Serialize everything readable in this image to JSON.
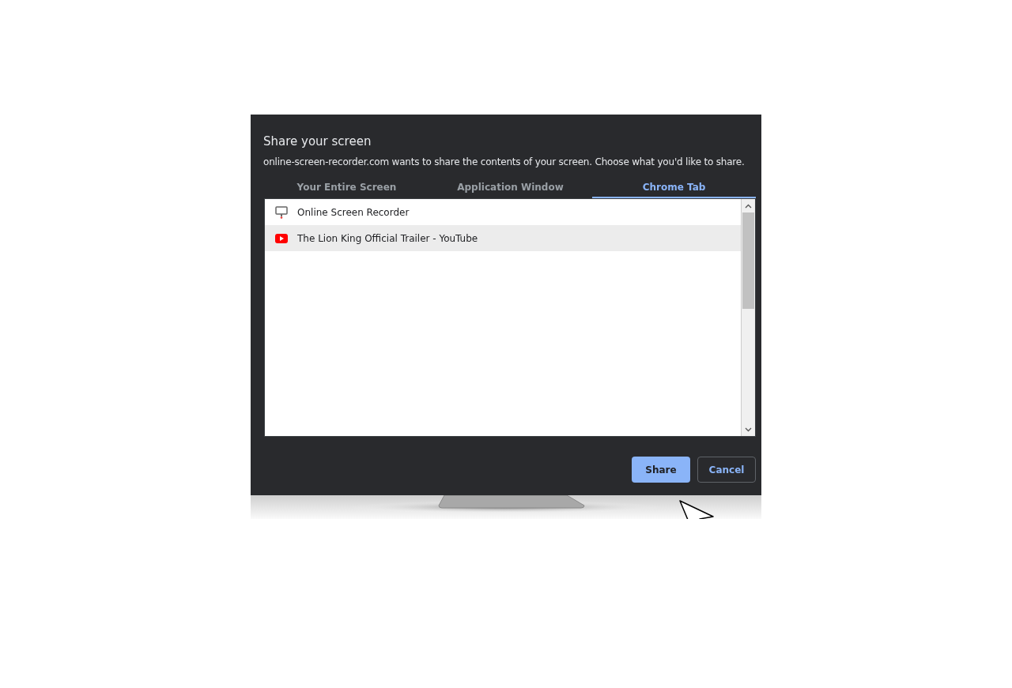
{
  "dialog": {
    "title": "Share your screen",
    "message": "online-screen-recorder.com wants to share the contents of your screen. Choose what you'd like to share.",
    "tabs": [
      {
        "label": "Your Entire Screen",
        "selected": false
      },
      {
        "label": "Application Window",
        "selected": false
      },
      {
        "label": "Chrome Tab",
        "selected": true
      }
    ],
    "items": [
      {
        "kind": "monitor",
        "title": "Online Screen Recorder",
        "selected": false
      },
      {
        "kind": "video",
        "title": "The Lion King Official Trailer - YouTube",
        "selected": true
      }
    ],
    "buttons": [
      {
        "label": "Share",
        "kind": "primary"
      },
      {
        "label": "Cancel",
        "kind": "secondary"
      }
    ]
  }
}
